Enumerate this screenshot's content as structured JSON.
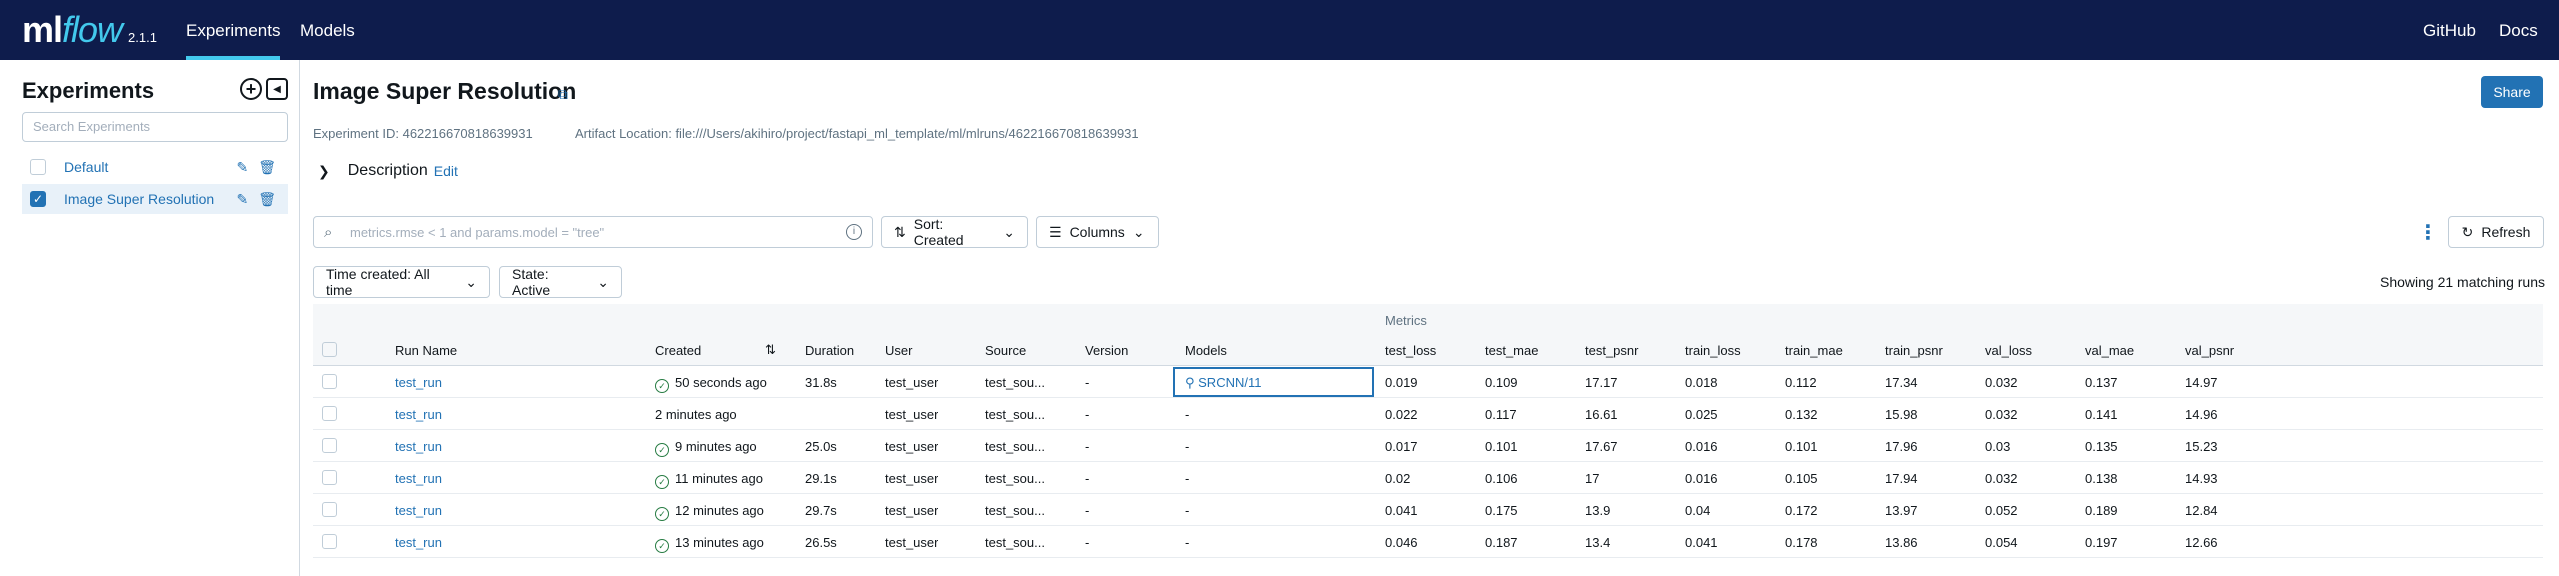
{
  "header": {
    "logo_ml": "ml",
    "logo_flow": "flow",
    "version": "2.1.1",
    "nav": [
      "Experiments",
      "Models"
    ],
    "right": [
      "GitHub",
      "Docs"
    ]
  },
  "sidebar": {
    "title": "Experiments",
    "search_placeholder": "Search Experiments",
    "items": [
      {
        "label": "Default",
        "checked": false
      },
      {
        "label": "Image Super Resolution",
        "checked": true
      }
    ]
  },
  "main": {
    "title": "Image Super Resolution",
    "share_label": "Share",
    "experiment_id": "Experiment ID: 462216670818639931",
    "artifact_location": "Artifact Location: file:///Users/akihiro/project/fastapi_ml_template/ml/mlruns/462216670818639931",
    "description_label": "Description",
    "edit_label": "Edit",
    "search_placeholder": "metrics.rmse < 1 and params.model = \"tree\"",
    "sort_label": "Sort: Created",
    "columns_label": "Columns",
    "refresh_label": "Refresh",
    "time_filter": "Time created: All time",
    "state_filter": "State: Active",
    "showing": "Showing 21 matching runs"
  },
  "table": {
    "group_label": "Metrics",
    "headers": [
      "Run Name",
      "Created",
      "Duration",
      "User",
      "Source",
      "Version",
      "Models",
      "test_loss",
      "test_mae",
      "test_psnr",
      "train_loss",
      "train_mae",
      "train_psnr",
      "val_loss",
      "val_mae",
      "val_psnr"
    ],
    "rows": [
      {
        "name": "test_run",
        "created": "50 seconds ago",
        "status_ok": true,
        "duration": "31.8s",
        "user": "test_user",
        "source": "test_sou...",
        "version": "-",
        "models": "SRCNN/11",
        "test_loss": "0.019",
        "test_mae": "0.109",
        "test_psnr": "17.17",
        "train_loss": "0.018",
        "train_mae": "0.112",
        "train_psnr": "17.34",
        "val_loss": "0.032",
        "val_mae": "0.137",
        "val_psnr": "14.97"
      },
      {
        "name": "test_run",
        "created": "2 minutes ago",
        "status_ok": false,
        "duration": "",
        "user": "test_user",
        "source": "test_sou...",
        "version": "-",
        "models": "-",
        "test_loss": "0.022",
        "test_mae": "0.117",
        "test_psnr": "16.61",
        "train_loss": "0.025",
        "train_mae": "0.132",
        "train_psnr": "15.98",
        "val_loss": "0.032",
        "val_mae": "0.141",
        "val_psnr": "14.96"
      },
      {
        "name": "test_run",
        "created": "9 minutes ago",
        "status_ok": true,
        "duration": "25.0s",
        "user": "test_user",
        "source": "test_sou...",
        "version": "-",
        "models": "-",
        "test_loss": "0.017",
        "test_mae": "0.101",
        "test_psnr": "17.67",
        "train_loss": "0.016",
        "train_mae": "0.101",
        "train_psnr": "17.96",
        "val_loss": "0.03",
        "val_mae": "0.135",
        "val_psnr": "15.23"
      },
      {
        "name": "test_run",
        "created": "11 minutes ago",
        "status_ok": true,
        "duration": "29.1s",
        "user": "test_user",
        "source": "test_sou...",
        "version": "-",
        "models": "-",
        "test_loss": "0.02",
        "test_mae": "0.106",
        "test_psnr": "17",
        "train_loss": "0.016",
        "train_mae": "0.105",
        "train_psnr": "17.94",
        "val_loss": "0.032",
        "val_mae": "0.138",
        "val_psnr": "14.93"
      },
      {
        "name": "test_run",
        "created": "12 minutes ago",
        "status_ok": true,
        "duration": "29.7s",
        "user": "test_user",
        "source": "test_sou...",
        "version": "-",
        "models": "-",
        "test_loss": "0.041",
        "test_mae": "0.175",
        "test_psnr": "13.9",
        "train_loss": "0.04",
        "train_mae": "0.172",
        "train_psnr": "13.97",
        "val_loss": "0.052",
        "val_mae": "0.189",
        "val_psnr": "12.84"
      },
      {
        "name": "test_run",
        "created": "13 minutes ago",
        "status_ok": true,
        "duration": "26.5s",
        "user": "test_user",
        "source": "test_sou...",
        "version": "-",
        "models": "-",
        "test_loss": "0.046",
        "test_mae": "0.187",
        "test_psnr": "13.4",
        "train_loss": "0.041",
        "train_mae": "0.178",
        "train_psnr": "13.86",
        "val_loss": "0.054",
        "val_mae": "0.197",
        "val_psnr": "12.66"
      }
    ]
  },
  "colors": {
    "header_bg": "#0e1c4c",
    "accent": "#2272b4",
    "logo_accent": "#43c9ed",
    "success": "#277c43"
  },
  "icons": [
    "copy-icon",
    "search-icon",
    "info-icon",
    "sort-icon",
    "columns-icon",
    "refresh-icon",
    "kebab-icon",
    "chevron-right-icon",
    "chevron-down-icon",
    "pencil-icon",
    "trash-icon",
    "plus-icon",
    "collapse-icon",
    "check-circle-icon",
    "model-icon"
  ]
}
